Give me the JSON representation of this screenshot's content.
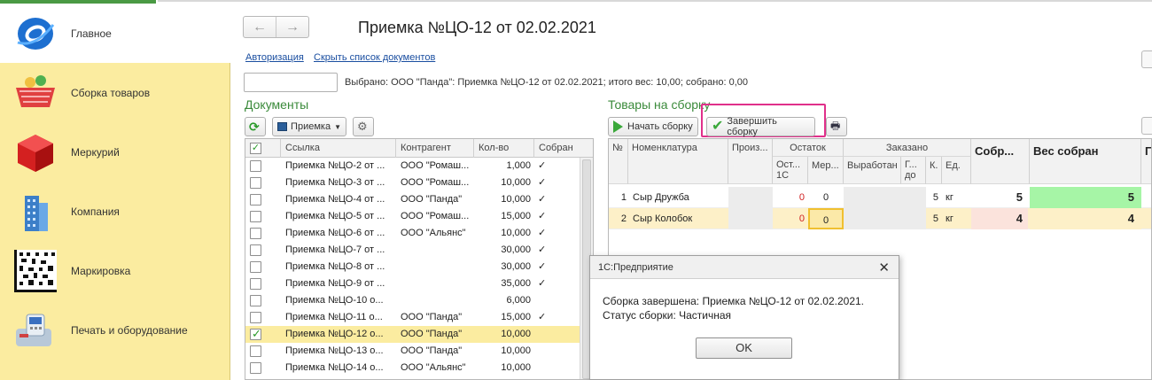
{
  "window_title": "Приемка №ЦО-12 от 02.02.2021",
  "sidebar": {
    "items": [
      {
        "label": "Главное",
        "icon": "main-logo-icon"
      },
      {
        "label": "Сборка товаров",
        "icon": "basket-icon"
      },
      {
        "label": "Меркурий",
        "icon": "mercury-cube-icon"
      },
      {
        "label": "Компания",
        "icon": "building-icon"
      },
      {
        "label": "Маркировка",
        "icon": "datamatrix-icon"
      },
      {
        "label": "Печать и оборудование",
        "icon": "pos-terminal-icon"
      }
    ]
  },
  "nav": {
    "back": "←",
    "forward": "→"
  },
  "links": {
    "auth": "Авторизация",
    "hide_docs": "Скрыть список документов"
  },
  "selected_info": "Выбрано: ООО \"Панда\": Приемка №ЦО-12 от 02.02.2021; итого вес: 10,00; собрано: 0,00",
  "documents": {
    "title": "Документы",
    "filter_label": "Приемка",
    "columns": [
      "Ссылка",
      "Контрагент",
      "Кол-во",
      "Собран"
    ],
    "rows": [
      {
        "link": "Приемка №ЦО-2 от ...",
        "contractor": "ООО \"Ромаш...",
        "qty": "1,000",
        "done": true,
        "checked": false
      },
      {
        "link": "Приемка №ЦО-3 от ...",
        "contractor": "ООО \"Ромаш...",
        "qty": "10,000",
        "done": true,
        "checked": false
      },
      {
        "link": "Приемка №ЦО-4 от ...",
        "contractor": "ООО \"Панда\"",
        "qty": "10,000",
        "done": true,
        "checked": false
      },
      {
        "link": "Приемка №ЦО-5 от ...",
        "contractor": "ООО \"Ромаш...",
        "qty": "15,000",
        "done": true,
        "checked": false
      },
      {
        "link": "Приемка №ЦО-6 от ...",
        "contractor": "ООО \"Альянс\"",
        "qty": "10,000",
        "done": true,
        "checked": false
      },
      {
        "link": "Приемка №ЦО-7 от ...",
        "contractor": "",
        "qty": "30,000",
        "done": true,
        "checked": false
      },
      {
        "link": "Приемка №ЦО-8 от ...",
        "contractor": "",
        "qty": "30,000",
        "done": true,
        "checked": false
      },
      {
        "link": "Приемка №ЦО-9 от ...",
        "contractor": "",
        "qty": "35,000",
        "done": true,
        "checked": false
      },
      {
        "link": "Приемка №ЦО-10 о...",
        "contractor": "",
        "qty": "6,000",
        "done": false,
        "checked": false
      },
      {
        "link": "Приемка №ЦО-11 о...",
        "contractor": "ООО \"Панда\"",
        "qty": "15,000",
        "done": true,
        "checked": false
      },
      {
        "link": "Приемка №ЦО-12 о...",
        "contractor": "ООО \"Панда\"",
        "qty": "10,000",
        "done": false,
        "checked": true
      },
      {
        "link": "Приемка №ЦО-13 о...",
        "contractor": "ООО \"Панда\"",
        "qty": "10,000",
        "done": false,
        "checked": false
      },
      {
        "link": "Приемка №ЦО-14 о...",
        "contractor": "ООО \"Альянс\"",
        "qty": "10,000",
        "done": false,
        "checked": false
      }
    ]
  },
  "goods": {
    "title": "Товары на сборку",
    "start_btn": "Начать сборку",
    "finish_btn": "Завершить сборку",
    "headers": {
      "num": "№",
      "nomenclature": "Номенклатура",
      "producer": "Произ...",
      "remainder": "Остаток",
      "remainder_1c": "Ост... 1С",
      "remainder_mer": "Мер...",
      "ordered": "Заказано",
      "produced": "Выработан",
      "good_until": "Г... до",
      "k": "К.",
      "unit": "Ед.",
      "collected": "Собр...",
      "weight_collected": "Вес собран",
      "extra": "Г"
    },
    "rows": [
      {
        "num": "1",
        "name": "Сыр Дружба",
        "rem1c": "0",
        "remmer": "0",
        "k": "5",
        "unit": "кг",
        "collected": "5",
        "weight": "5"
      },
      {
        "num": "2",
        "name": "Сыр Колобок",
        "rem1c": "0",
        "remmer": "0",
        "k": "5",
        "unit": "кг",
        "collected": "4",
        "weight": "4"
      }
    ]
  },
  "dialog": {
    "title": "1С:Предприятие",
    "close": "✕",
    "line1": "Сборка завершена: Приемка №ЦО-12 от 02.02.2021.",
    "line2": "Статус сборки: Частичная",
    "ok": "OK"
  },
  "colors": {
    "accent_green": "#3a8a3a",
    "sidebar_bg": "#fbeca0",
    "highlight": "#e0308a",
    "weight_ok": "#a6f5a6",
    "weight_partial": "#fbe3dc"
  }
}
